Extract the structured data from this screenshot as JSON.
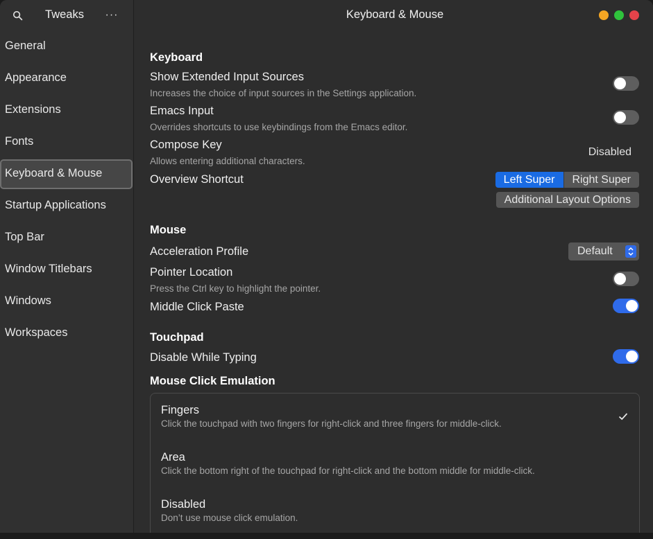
{
  "sidebar": {
    "title": "Tweaks",
    "search_icon": "search-icon",
    "menu_label": "···",
    "items": [
      {
        "label": "General"
      },
      {
        "label": "Appearance"
      },
      {
        "label": "Extensions"
      },
      {
        "label": "Fonts"
      },
      {
        "label": "Keyboard & Mouse",
        "active": true
      },
      {
        "label": "Startup Applications"
      },
      {
        "label": "Top Bar"
      },
      {
        "label": "Window Titlebars"
      },
      {
        "label": "Windows"
      },
      {
        "label": "Workspaces"
      }
    ]
  },
  "header": {
    "title": "Keyboard & Mouse",
    "window_buttons": {
      "minimize": "#f5a623",
      "maximize": "#2fc23c",
      "close": "#e5434a"
    }
  },
  "keyboard": {
    "section": "Keyboard",
    "extended_sources": {
      "label": "Show Extended Input Sources",
      "desc": "Increases the choice of input sources in the Settings application.",
      "on": false
    },
    "emacs": {
      "label": "Emacs Input",
      "desc": "Overrides shortcuts to use keybindings from the Emacs editor.",
      "on": false
    },
    "compose": {
      "label": "Compose Key",
      "desc": "Allows entering additional characters.",
      "value": "Disabled"
    },
    "overview": {
      "label": "Overview Shortcut",
      "left": "Left Super",
      "right": "Right Super",
      "selected": "Left Super"
    },
    "additional_layout": "Additional Layout Options"
  },
  "mouse": {
    "section": "Mouse",
    "accel": {
      "label": "Acceleration Profile",
      "value": "Default"
    },
    "pointer": {
      "label": "Pointer Location",
      "desc": "Press the Ctrl key to highlight the pointer.",
      "on": false
    },
    "middle_paste": {
      "label": "Middle Click Paste",
      "on": true
    }
  },
  "touchpad": {
    "section": "Touchpad",
    "disable_typing": {
      "label": "Disable While Typing",
      "on": true
    }
  },
  "click_emulation": {
    "section": "Mouse Click Emulation",
    "options": [
      {
        "title": "Fingers",
        "desc": "Click the touchpad with two fingers for right-click and three fingers for middle-click.",
        "selected": true
      },
      {
        "title": "Area",
        "desc": "Click the bottom right of the touchpad for right-click and the bottom middle for middle-click.",
        "selected": false
      },
      {
        "title": "Disabled",
        "desc": "Don’t use mouse click emulation.",
        "selected": false
      }
    ]
  },
  "colors": {
    "accent": "#2f6bea",
    "window_bg": "#2d2d2d",
    "sidebar_bg": "#303030"
  }
}
